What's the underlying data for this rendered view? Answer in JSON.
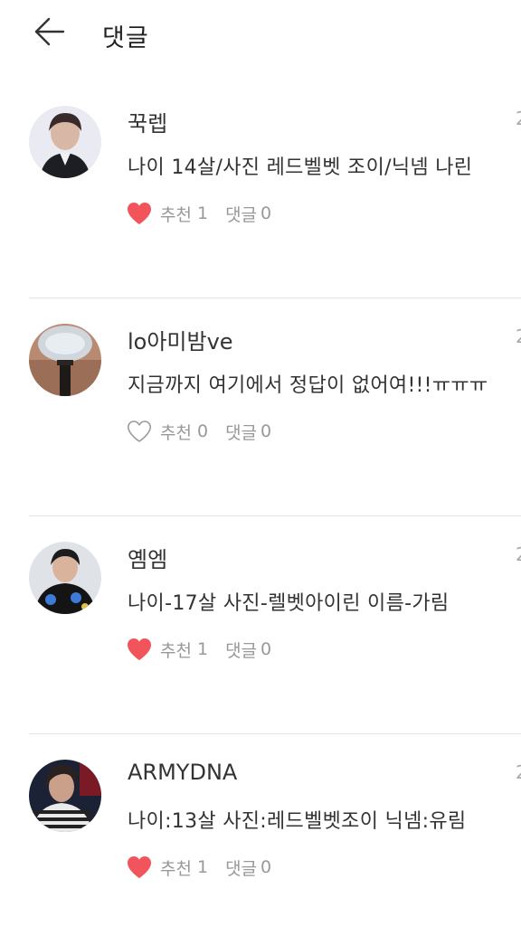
{
  "header": {
    "title": "댓글",
    "back_icon": "arrow-left-icon"
  },
  "comments": [
    {
      "author": "꾹렙",
      "text": "나이 14살/사진 레드벨벳 조이/닉넴 나린",
      "date_peek": "2",
      "liked": true,
      "like_label": "추천",
      "like_count": "1",
      "reply_label": "댓글",
      "reply_count": "0"
    },
    {
      "author": "lo아미밤ve",
      "text": "지금까지 여기에서 정답이 없어여!!!ㅠㅠㅠ",
      "date_peek": "2",
      "liked": false,
      "like_label": "추천",
      "like_count": "0",
      "reply_label": "댓글",
      "reply_count": "0"
    },
    {
      "author": "옘엠",
      "text": "나이-17살 사진-렐벳아이린 이름-가림",
      "date_peek": "2",
      "liked": true,
      "like_label": "추천",
      "like_count": "1",
      "reply_label": "댓글",
      "reply_count": "0"
    },
    {
      "author": "ARMYDNA",
      "text": "나이:13살 사진:레드벨벳조이 닉넴:유림",
      "date_peek": "2",
      "liked": true,
      "like_label": "추천",
      "like_count": "1",
      "reply_label": "댓글",
      "reply_count": "0"
    }
  ],
  "colors": {
    "heart_liked": "#f2545b",
    "heart_outline": "#9a9a9a",
    "meta_text": "#999999",
    "divider": "#e4e4e4"
  }
}
